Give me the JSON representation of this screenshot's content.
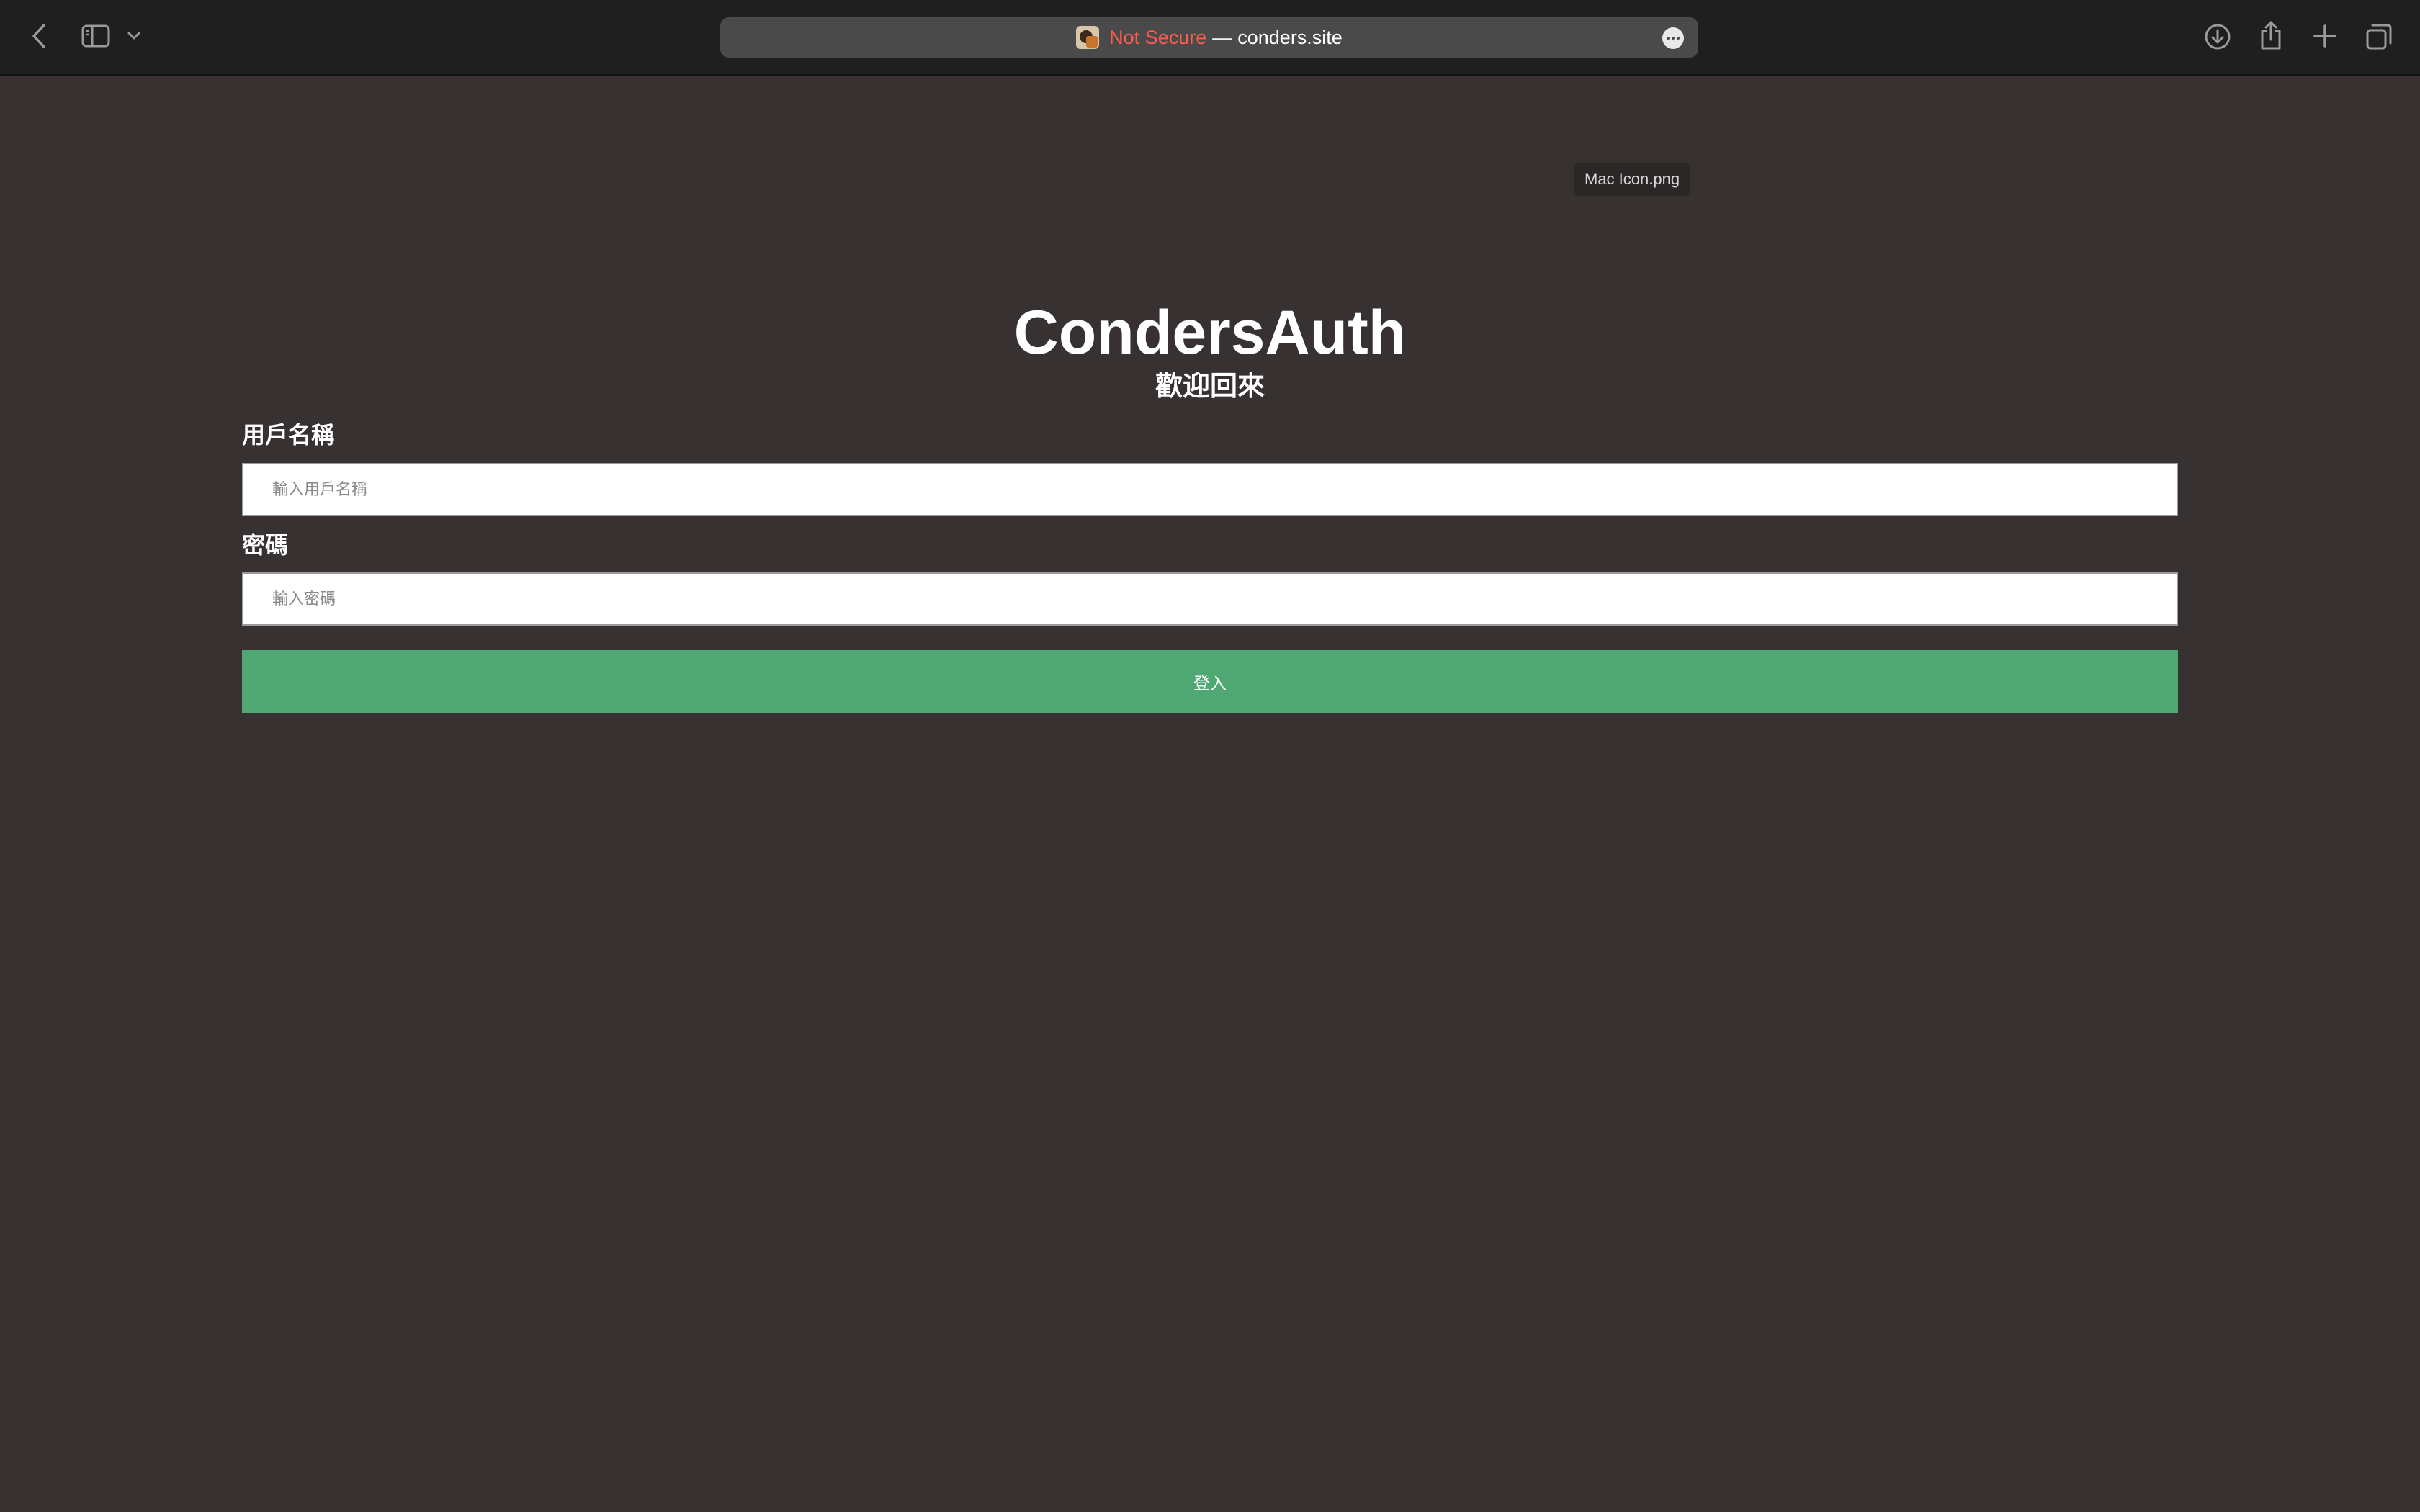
{
  "browser": {
    "address": {
      "security_label": "Not Secure",
      "separator": "—",
      "domain": "conders.site"
    }
  },
  "page": {
    "tooltip": "Mac Icon.png",
    "title": "CondersAuth",
    "subtitle": "歡迎回來",
    "form": {
      "username_label": "用戶名稱",
      "username_placeholder": "輸入用戶名稱",
      "username_value": "",
      "password_label": "密碼",
      "password_placeholder": "輸入密碼",
      "password_value": "",
      "submit_label": "登入"
    }
  },
  "colors": {
    "page_background": "#373131",
    "toolbar_background": "#1f1f1f",
    "not_secure": "#ff5a4e",
    "login_button": "#4fa774"
  },
  "icons": {
    "toolbar_left": [
      "back-arrow-icon",
      "sidebar-icon",
      "chevron-down-icon"
    ],
    "toolbar_right": [
      "download-icon",
      "share-icon",
      "plus-icon",
      "tabs-overview-icon"
    ],
    "address_bar": [
      "site-favicon-icon",
      "more-options-icon"
    ]
  }
}
